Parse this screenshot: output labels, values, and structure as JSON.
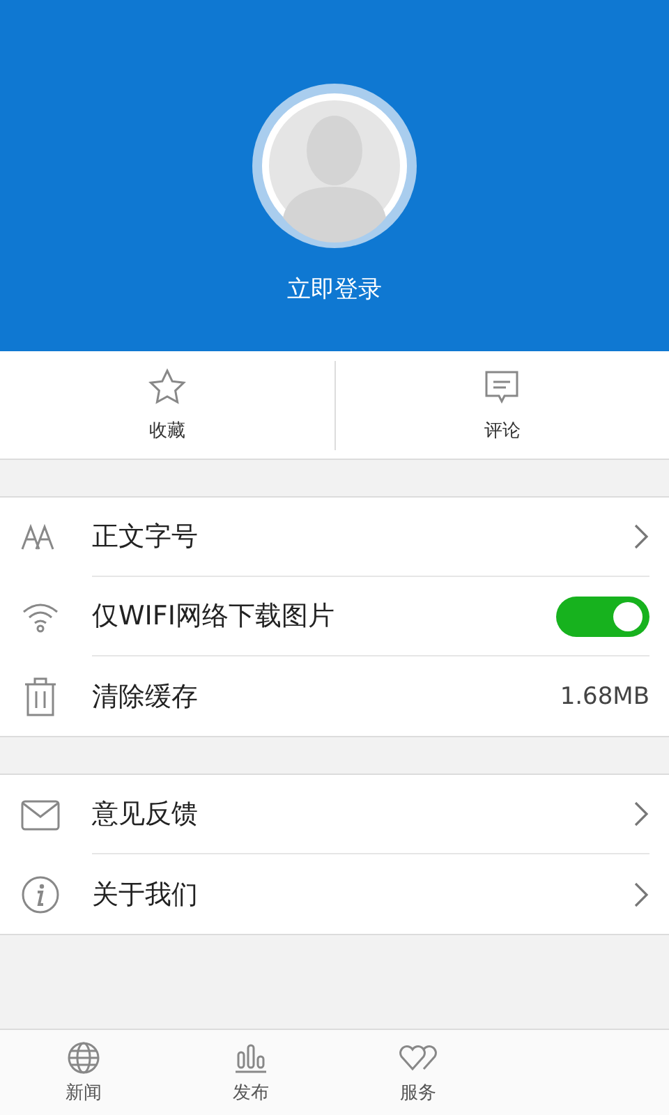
{
  "profile": {
    "login_label": "立即登录"
  },
  "actions": [
    {
      "label": "收藏"
    },
    {
      "label": "评论"
    }
  ],
  "settings_groups": [
    [
      {
        "label": "正文字号",
        "kind": "chevron"
      },
      {
        "label": "仅WIFI网络下载图片",
        "kind": "toggle",
        "on": true
      },
      {
        "label": "清除缓存",
        "kind": "value",
        "value": "1.68MB"
      }
    ],
    [
      {
        "label": "意见反馈",
        "kind": "chevron"
      },
      {
        "label": "关于我们",
        "kind": "chevron"
      }
    ]
  ],
  "bottom_nav": [
    {
      "label": "新闻",
      "selected": false
    },
    {
      "label": "发布",
      "selected": false
    },
    {
      "label": "服务",
      "selected": false
    }
  ]
}
